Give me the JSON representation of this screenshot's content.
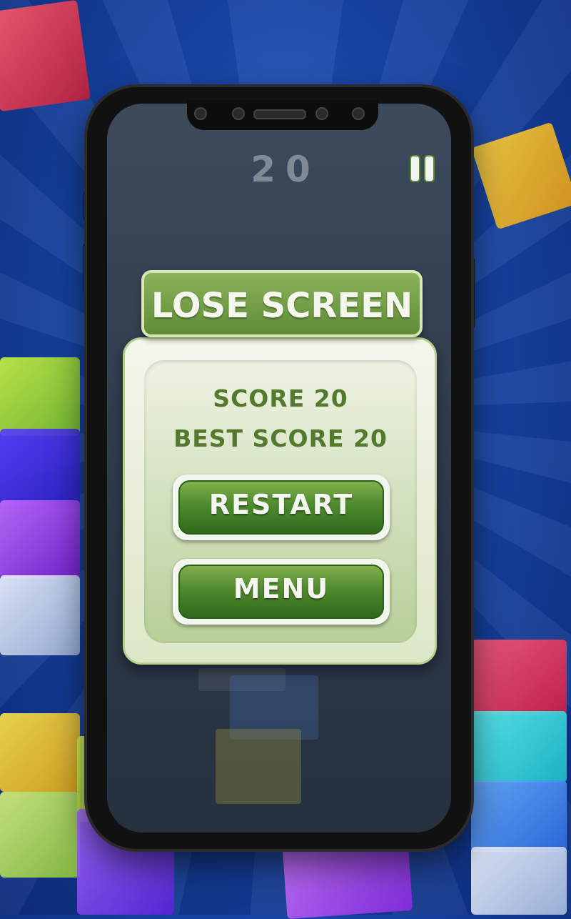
{
  "top_score": "20",
  "dialog": {
    "title": "LOSE SCREEN",
    "score_line": "SCORE 20",
    "best_score_line": "BEST SCORE 20"
  },
  "buttons": {
    "restart_label": "RESTART",
    "menu_label": "MENU"
  },
  "colors": {
    "background": "#1746a8",
    "panel_green": "#5f8c36",
    "text_green": "#557a2f",
    "button_green": "#4f8a2e"
  },
  "icons": [
    "pause-icon"
  ]
}
